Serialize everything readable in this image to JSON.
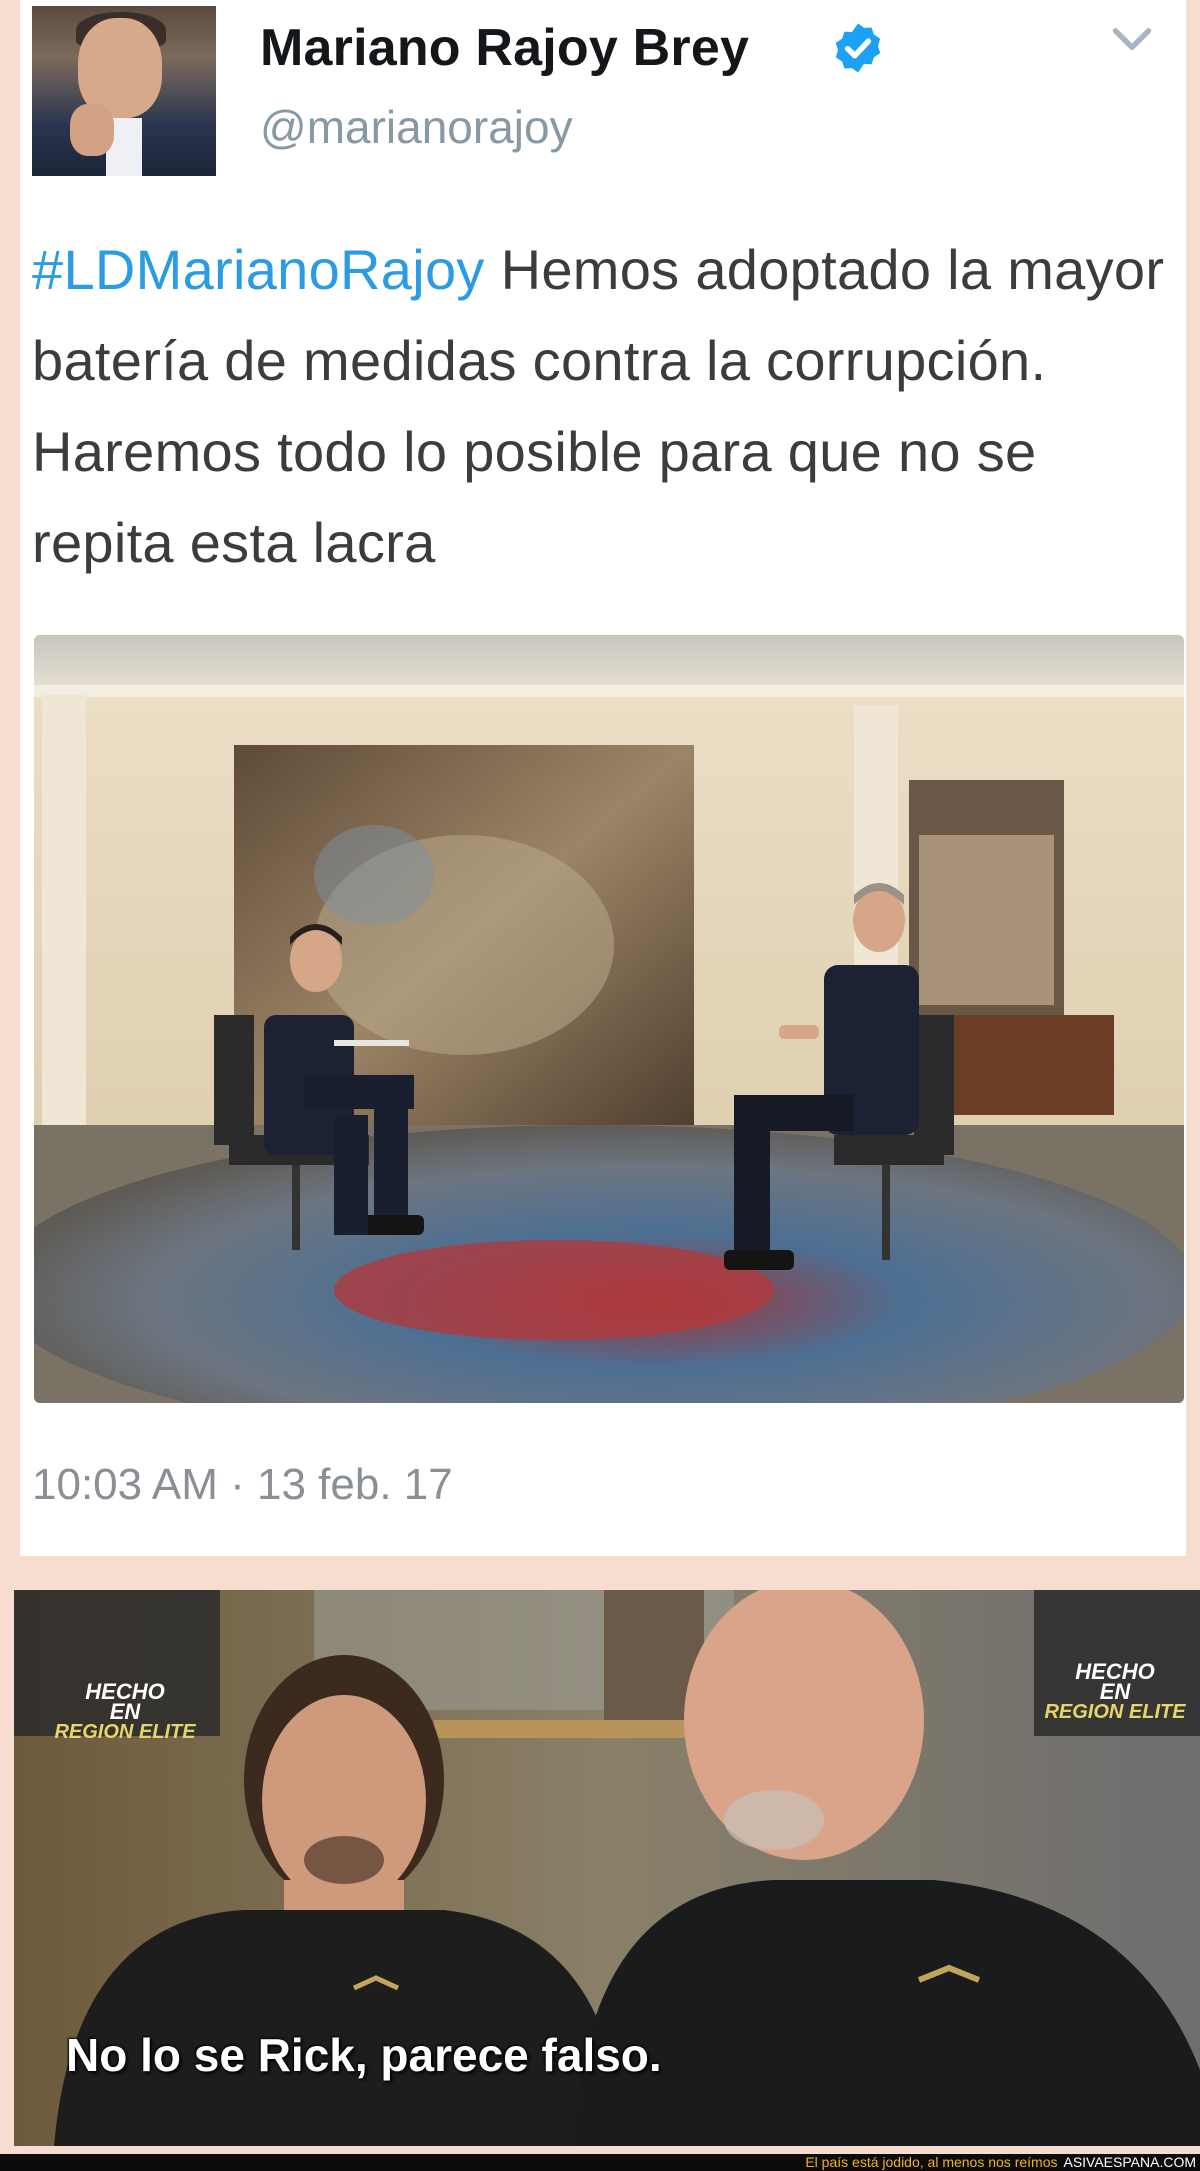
{
  "tweet": {
    "author_name": "Mariano Rajoy Brey",
    "handle": "@marianorajoy",
    "hashtag": "#LDMarianoRajoy",
    "text_after_hashtag": "Hemos adoptado la mayor batería de medidas contra la corrupción. Haremos todo lo posible para que no se repita esta lacra",
    "timestamp": "10:03 AM · 13 feb. 17"
  },
  "icons": {
    "verified": "verified-badge-icon",
    "caret": "chevron-down-icon"
  },
  "colors": {
    "hashtag": "#2b9ce3",
    "verified": "#1da1f2",
    "handle": "#8899a6",
    "footer_caption": "#f2b21b"
  },
  "meme": {
    "watermark_line1": "HECHO",
    "watermark_line2": "EN",
    "watermark_line3": "REGION ELITE",
    "subtitle": "No lo se Rick, parece falso."
  },
  "footer": {
    "caption": "El país está jodido, al menos nos reímos",
    "signature": "ASIVAESPANA.COM"
  }
}
